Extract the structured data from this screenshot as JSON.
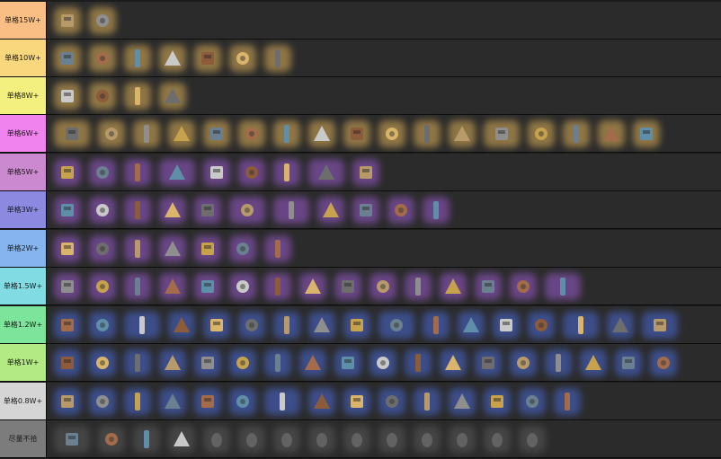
{
  "tiers": [
    {
      "label": "单格15W+",
      "color": "#f9be83",
      "glow": "#e0b35a",
      "items": [
        "camera-icon",
        "gold-box-icon"
      ]
    },
    {
      "label": "单格10W+",
      "color": "#f9d77d",
      "glow": "#e0b35a",
      "items": [
        "drone-icon",
        "gear-cube-icon",
        "mushroom-lamp-icon",
        "tablet-icon",
        "canister-icon",
        "helmet-icon",
        "figurine-icon"
      ]
    },
    {
      "label": "单格8W+",
      "color": "#f3f07f",
      "glow": "#e0b35a",
      "items": [
        "flask-icon",
        "card-icon",
        "radio-icon",
        "drive-icon"
      ]
    },
    {
      "label": "单格6W+",
      "color": "#f083ee",
      "glow": "#e0b35a",
      "items": [
        "server-icon",
        "hard-drive-icon",
        "box-icon",
        "vial-icon",
        "bottle-icon",
        "gem-icon",
        "safe-icon",
        "statue-icon",
        "chip-icon",
        "owl-icon",
        "drone-small-icon",
        "battery-icon",
        "rifle-icon",
        "phone-icon",
        "usb-icon",
        "egg-icon",
        "cake-icon"
      ]
    },
    {
      "label": "单格5W+",
      "color": "#cb89cf",
      "glow": "#9b5bd0",
      "items": [
        "bell-icon",
        "coin-icon",
        "idol-icon",
        "bag-icon",
        "tube-icon",
        "lamp-icon",
        "candle-icon",
        "crown-icon",
        "soda-icon"
      ]
    },
    {
      "label": "单格3W+",
      "color": "#8c8ae0",
      "glow": "#9b5bd0",
      "items": [
        "badge-icon",
        "knife-icon",
        "camera-small-icon",
        "binoculars-icon",
        "crate-icon",
        "lens-icon",
        "board-icon",
        "rock-icon",
        "blade-icon",
        "wrench-icon",
        "pyramid-icon"
      ]
    },
    {
      "label": "单格2W+",
      "color": "#86b4ee",
      "glow": "#9b5bd0",
      "items": [
        "pen-icon",
        "screw-icon",
        "shell-icon",
        "stick-icon",
        "marker-icon",
        "brush-icon",
        "dagger-icon"
      ]
    },
    {
      "label": "单格1.5W+",
      "color": "#80dbe3",
      "glow": "#9b5bd0",
      "items": [
        "plate-icon",
        "fork-icon",
        "jar-icon",
        "car-battery-icon",
        "trophy-icon",
        "clock-icon",
        "vase-icon",
        "scope-icon",
        "reel-icon",
        "can-icon",
        "syringe-icon",
        "cigar-icon",
        "axe-icon",
        "disc-icon",
        "drill-icon"
      ]
    },
    {
      "label": "单格1.2W+",
      "color": "#7de49b",
      "glow": "#4a6ad8",
      "items": [
        "cup-icon",
        "keyboard-icon",
        "panel-icon",
        "filter-icon",
        "cross-icon",
        "tray-icon",
        "fan-icon",
        "tap-icon",
        "map-icon",
        "boombox-icon",
        "pin-icon",
        "lantern-icon",
        "flask-small-icon",
        "cake-small-icon",
        "scroll-icon",
        "cube-icon",
        "rail-icon"
      ]
    },
    {
      "label": "单格1W+",
      "color": "#b4ea83",
      "glow": "#4a6ad8",
      "items": [
        "pipe-icon",
        "book-icon",
        "toolbox-icon",
        "slate-icon",
        "tower-icon",
        "pump-icon",
        "spray-icon",
        "hammer-icon",
        "lighter-icon",
        "bucket-icon",
        "mask-icon",
        "grill-icon",
        "phone-small-icon",
        "eraser-icon",
        "tape-icon",
        "can-small-icon",
        "pencil-icon",
        "stick-small-icon"
      ]
    },
    {
      "label": "单格0.8W+",
      "color": "#d5d5d5",
      "glow": "#4a6ad8",
      "items": [
        "necklace-icon",
        "chip-small-icon",
        "leaf-icon",
        "ring-icon",
        "bag-small-icon",
        "tool-icon",
        "scanner-icon",
        "cable-icon",
        "photo-icon",
        "rod-icon",
        "cable-small-icon",
        "radio-small-icon",
        "stapler-icon",
        "sticker-icon",
        "bottle-small-icon"
      ]
    },
    {
      "label": "尽量不拾",
      "color": "#7c7c7c",
      "glow": "#5a5a5a",
      "items": [
        "solar-panel-icon",
        "monitor-icon",
        "paper-icon",
        "bottle-red-icon",
        "ghost-1-icon",
        "ghost-2-icon",
        "ghost-3-icon",
        "ghost-4-icon",
        "ghost-5-icon",
        "ghost-6-icon",
        "ghost-7-icon",
        "ghost-8-icon",
        "ghost-9-icon",
        "ghost-10-icon"
      ]
    }
  ]
}
